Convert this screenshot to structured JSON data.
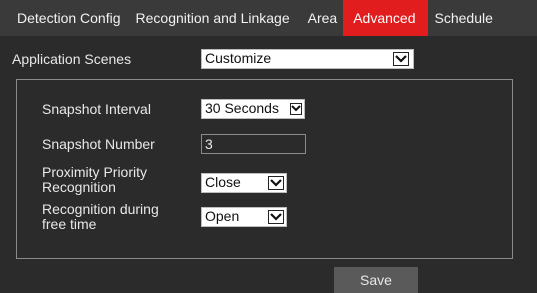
{
  "tabs": [
    {
      "label": "Detection Config"
    },
    {
      "label": "Recognition and Linkage"
    },
    {
      "label": "Area"
    },
    {
      "label": "Advanced"
    },
    {
      "label": "Schedule"
    }
  ],
  "active_tab": "Advanced",
  "application_scenes": {
    "label": "Application Scenes",
    "value": "Customize"
  },
  "settings": {
    "snapshot_interval": {
      "label": "Snapshot Interval",
      "value": "30 Seconds"
    },
    "snapshot_number": {
      "label": "Snapshot Number",
      "value": "3"
    },
    "proximity_priority": {
      "label_line1": "Proximity Priority",
      "label_line2": "Recognition",
      "value": "Close"
    },
    "recognition_free_time": {
      "label_line1": "Recognition during",
      "label_line2": "free time",
      "value": "Open"
    }
  },
  "save_label": "Save",
  "colors": {
    "active_tab": "#e21d1d",
    "background": "#2b2b2b",
    "tabbar": "#3a3a3a",
    "save_button": "#5a5a5a"
  },
  "icons": {
    "dropdown": "chevron-down-icon"
  }
}
